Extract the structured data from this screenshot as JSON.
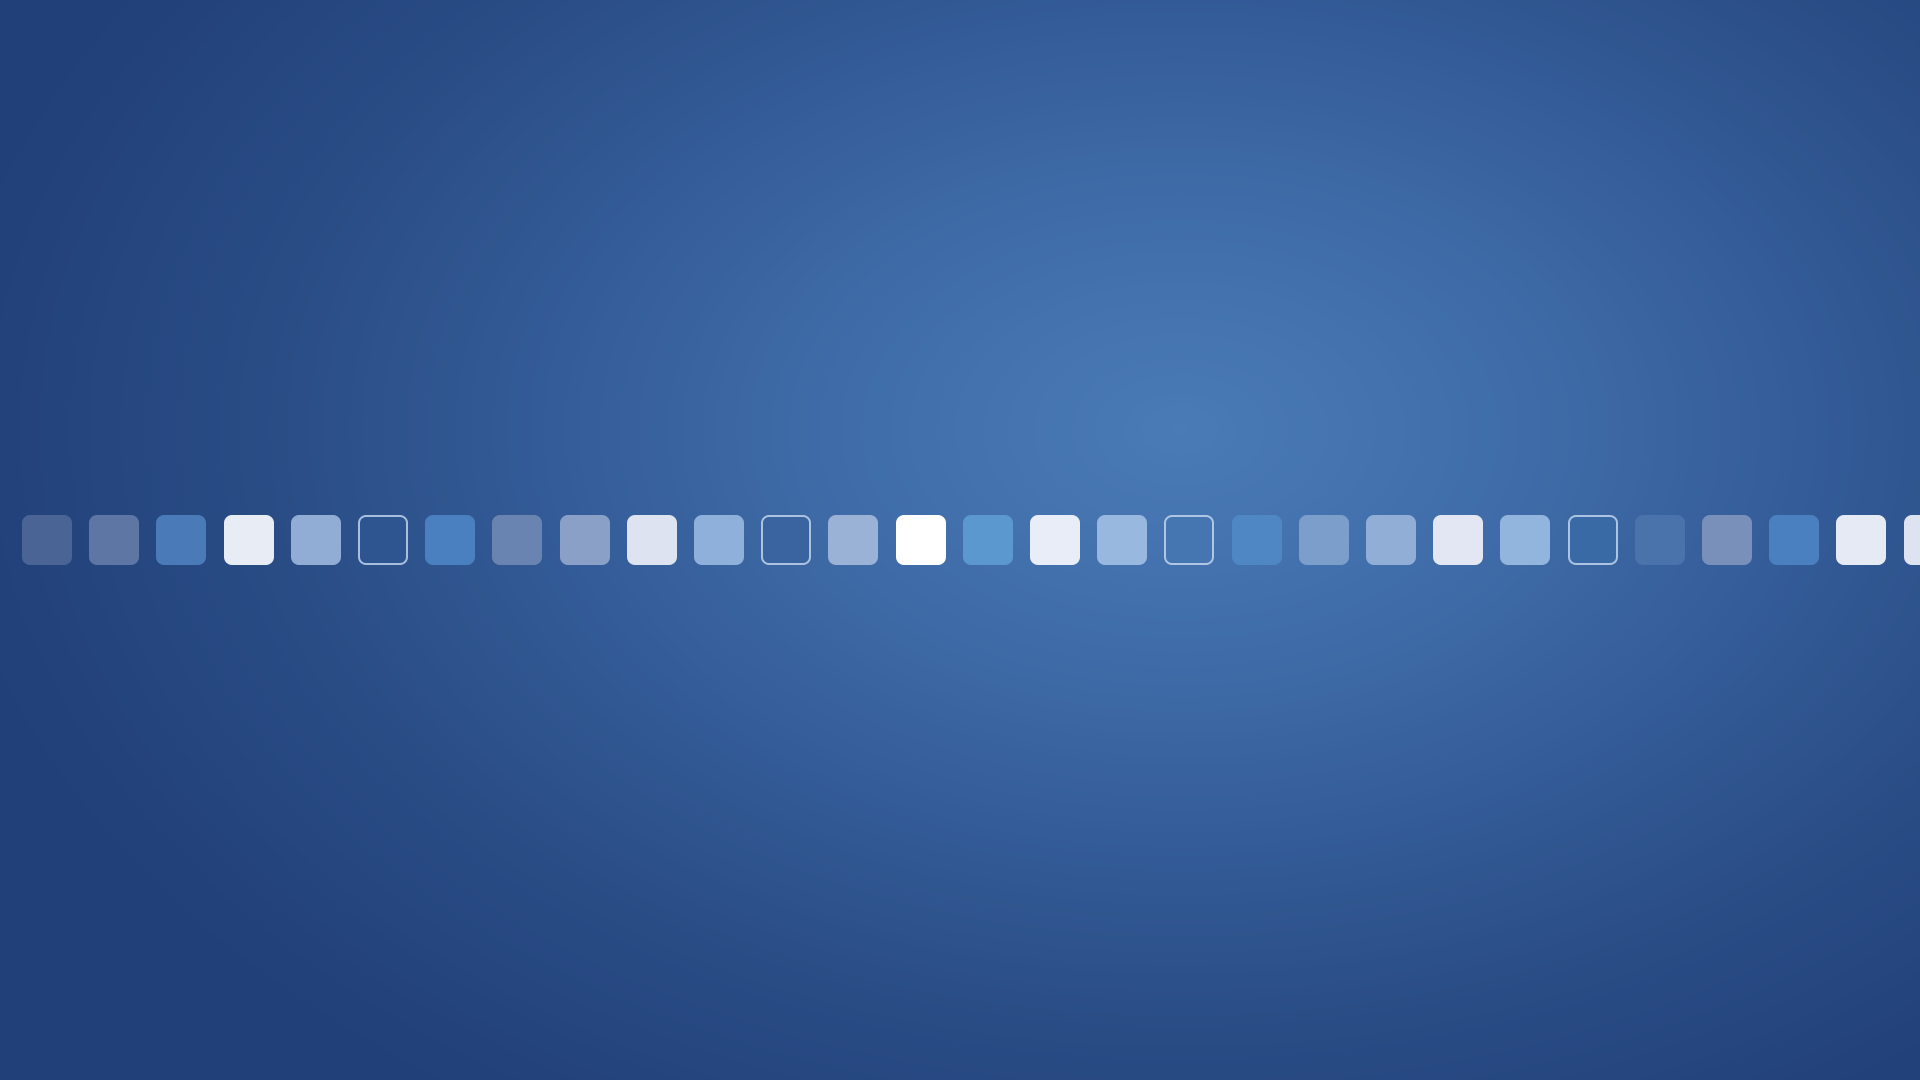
{
  "wallpaper": {
    "colors": {
      "center": "#4a7bb7",
      "edge": "#213f78"
    }
  },
  "tiles": [
    {
      "fill": "#4a6496",
      "outline": false
    },
    {
      "fill": "#5e76a4",
      "outline": false
    },
    {
      "fill": "#4a7ab8",
      "outline": false
    },
    {
      "fill": "#e8ecf5",
      "outline": false
    },
    {
      "fill": "#91add6",
      "outline": false
    },
    {
      "fill": "#2f5590",
      "outline": true
    },
    {
      "fill": "#4a80bf",
      "outline": false
    },
    {
      "fill": "#6a84b2",
      "outline": false
    },
    {
      "fill": "#8aa0c6",
      "outline": false
    },
    {
      "fill": "#dde3f0",
      "outline": false
    },
    {
      "fill": "#8fb0da",
      "outline": false
    },
    {
      "fill": "#3a649f",
      "outline": true
    },
    {
      "fill": "#9ab2d6",
      "outline": false
    },
    {
      "fill": "#ffffff",
      "outline": false
    },
    {
      "fill": "#5b98cf",
      "outline": false
    },
    {
      "fill": "#e8edf7",
      "outline": false
    },
    {
      "fill": "#98b8e0",
      "outline": false
    },
    {
      "fill": "#4676b2",
      "outline": true
    },
    {
      "fill": "#4f87c4",
      "outline": false
    },
    {
      "fill": "#7c9ecb",
      "outline": false
    },
    {
      "fill": "#91aed6",
      "outline": false
    },
    {
      "fill": "#e2e7f3",
      "outline": false
    },
    {
      "fill": "#92b5dd",
      "outline": false
    },
    {
      "fill": "#3a6aa6",
      "outline": true
    },
    {
      "fill": "#4a73ac",
      "outline": false
    },
    {
      "fill": "#7890ba",
      "outline": false
    },
    {
      "fill": "#4b80c0",
      "outline": false
    },
    {
      "fill": "#e6eaf4",
      "outline": false
    },
    {
      "fill": "#dde3f0",
      "outline": false
    }
  ]
}
